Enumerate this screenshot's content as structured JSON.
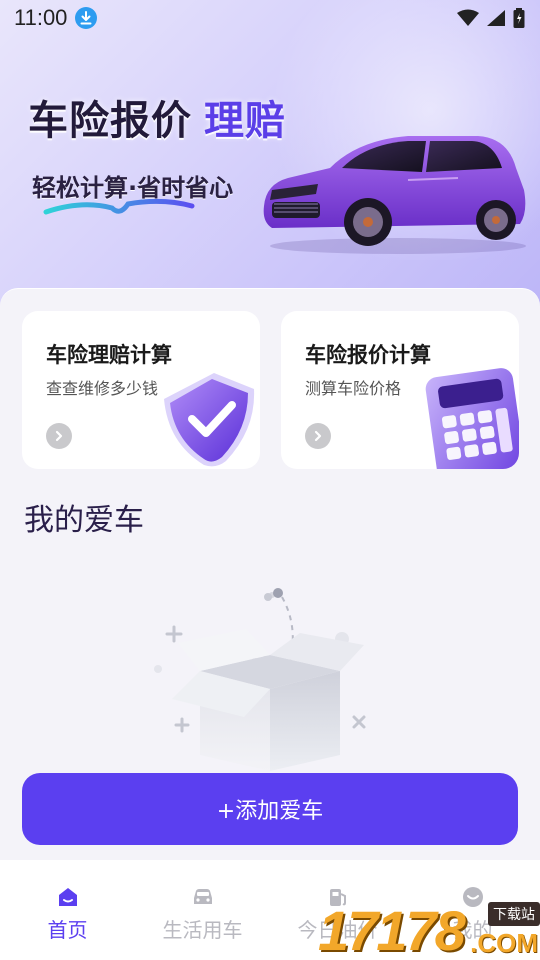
{
  "status_bar": {
    "time": "11:00"
  },
  "hero": {
    "title": "车险报价",
    "title_accent": "理赔",
    "slogan": "轻松计算·省时省心"
  },
  "cards": [
    {
      "title": "车险理赔计算",
      "subtitle": "查查维修多少钱",
      "icon": "shield-check-icon"
    },
    {
      "title": "车险报价计算",
      "subtitle": "测算车险价格",
      "icon": "calculator-icon"
    }
  ],
  "my_car": {
    "title": "我的爱车",
    "empty_icon": "empty-box-icon"
  },
  "add_button": {
    "label": "+添加爱车"
  },
  "tabbar": {
    "tabs": [
      {
        "label": "首页",
        "icon": "home-icon",
        "active": true
      },
      {
        "label": "生活用车",
        "icon": "car-icon",
        "active": false
      },
      {
        "label": "今日油价",
        "icon": "fuel-icon",
        "active": false
      },
      {
        "label": "我的",
        "icon": "profile-icon",
        "active": false
      }
    ]
  },
  "watermark": {
    "digits": "17178",
    "tag": "下载站",
    "suffix": ".COM"
  },
  "colors": {
    "accent": "#5b3ff0",
    "hero_bg": "#d6d1fb",
    "page_bg": "#f4f3f9",
    "tab_inactive": "#b9b9c0"
  }
}
